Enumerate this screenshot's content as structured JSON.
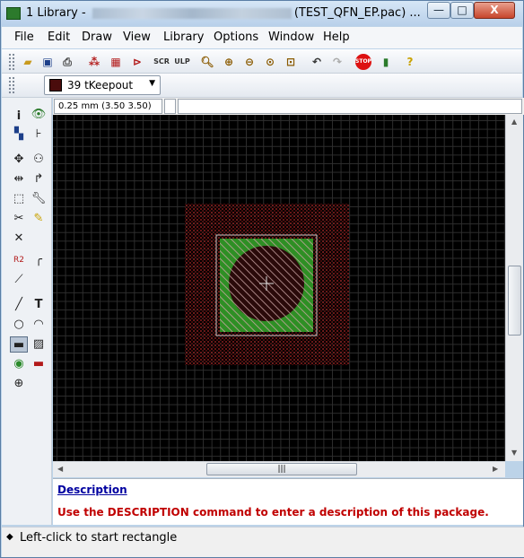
{
  "window": {
    "title_prefix": "1 Library - ",
    "title_suffix": "(TEST_QFN_EP.pac) ...",
    "min": "—",
    "max": "□",
    "close": "X"
  },
  "menu": [
    "File",
    "Edit",
    "Draw",
    "View",
    "Library",
    "Options",
    "Window",
    "Help"
  ],
  "toolbar_icons": [
    "open-icon",
    "save-icon",
    "print-icon",
    "package-icon",
    "device-icon",
    "symbol-icon",
    "script-icon",
    "ulp-icon",
    "zoom-fit-icon",
    "zoom-in-icon",
    "zoom-out-icon",
    "zoom-redraw-icon",
    "zoom-select-icon",
    "undo-icon",
    "redo-icon",
    "stop-icon",
    "go-icon",
    "help-icon"
  ],
  "layer": {
    "number": "39",
    "name": "39 tKeepout",
    "swatch_color": "#4a0c0c"
  },
  "coord": {
    "text": "0.25 mm (3.50 3.50)"
  },
  "leftbar_tools": [
    "info",
    "show",
    "display",
    "mark",
    "move",
    "copy",
    "mirror",
    "rotate",
    "group",
    "change",
    "cut",
    "paste",
    "delete",
    "add",
    "name",
    "value",
    "smash",
    "miter",
    "split",
    "wire",
    "text",
    "circle",
    "arc",
    "rect",
    "polygon",
    "via",
    "smd",
    "hole"
  ],
  "description": {
    "link": "Description",
    "text": "Use the DESCRIPTION command to enter a description of this package."
  },
  "status": {
    "text": "Left-click to start rectangle"
  },
  "colors": {
    "keepout_hatch": "#8a1e1e",
    "pad_green": "#2e8f24",
    "outline": "#c8c8c8",
    "grid": "#2e2e2e"
  }
}
